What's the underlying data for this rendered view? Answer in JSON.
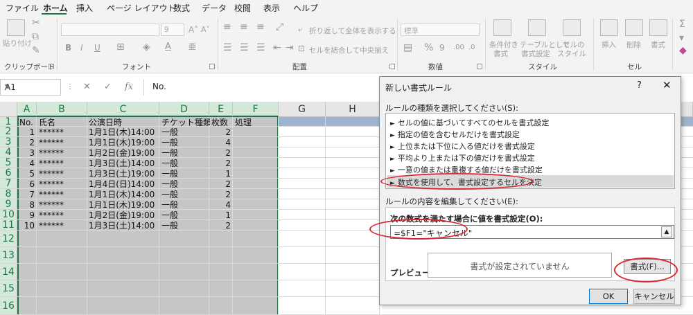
{
  "menu": [
    "ファイル",
    "ホーム",
    "挿入",
    "ページ レイアウト",
    "数式",
    "データ",
    "校閲",
    "表示",
    "ヘルプ"
  ],
  "ribbon": {
    "paste_label": "貼り付け",
    "groups": [
      "クリップボード",
      "フォント",
      "配置",
      "数値",
      "スタイル",
      "セル"
    ],
    "font_size": "9",
    "wrap_text": "折り返して全体を表示する",
    "merge_center": "セルを結合して中央揃え",
    "number_format": "標準",
    "cond_format": [
      "条件付き",
      "書式"
    ],
    "table_format": [
      "テーブルとして",
      "書式設定"
    ],
    "cell_style": [
      "セルの",
      "スタイル"
    ],
    "insert": "挿入",
    "delete": "削除",
    "format": "書式"
  },
  "formula_bar": {
    "name_box": "A1",
    "fx": "fx",
    "value": "No."
  },
  "columns": [
    "A",
    "B",
    "C",
    "D",
    "E",
    "F",
    "G",
    "H"
  ],
  "rows": [
    "1",
    "2",
    "3",
    "4",
    "5",
    "6",
    "7",
    "8",
    "9",
    "10",
    "11",
    "12",
    "13",
    "14",
    "15",
    "16"
  ],
  "table": {
    "headers": [
      "No.",
      "氏名",
      "公演日時",
      "チケット種類",
      "枚数",
      "処理"
    ],
    "rows": [
      [
        "1",
        "******",
        "1月1日(木)14:00",
        "一般",
        "2"
      ],
      [
        "2",
        "******",
        "1月1日(木)19:00",
        "一般",
        "4"
      ],
      [
        "3",
        "******",
        "1月2日(金)19:00",
        "一般",
        "2"
      ],
      [
        "4",
        "******",
        "1月3日(土)14:00",
        "一般",
        "2"
      ],
      [
        "5",
        "******",
        "1月3日(土)19:00",
        "一般",
        "1"
      ],
      [
        "6",
        "******",
        "1月4日(日)14:00",
        "一般",
        "2"
      ],
      [
        "7",
        "******",
        "1月1日(木)14:00",
        "一般",
        "2"
      ],
      [
        "8",
        "******",
        "1月1日(木)19:00",
        "一般",
        "4"
      ],
      [
        "9",
        "******",
        "1月2日(金)19:00",
        "一般",
        "1"
      ],
      [
        "10",
        "******",
        "1月3日(土)14:00",
        "一般",
        "2"
      ]
    ]
  },
  "dialog": {
    "title": "新しい書式ルール",
    "help": "?",
    "close": "✕",
    "rule_type_label": "ルールの種類を選択してください(S):",
    "rule_types": [
      "セルの値に基づいてすべてのセルを書式設定",
      "指定の値を含むセルだけを書式設定",
      "上位または下位に入る値だけを書式設定",
      "平均より上または下の値だけを書式設定",
      "一意の値または重複する値だけを書式設定",
      "数式を使用して、書式設定するセルを決定"
    ],
    "edit_label": "ルールの内容を編集してください(E):",
    "formula_label": "次の数式を満たす場合に値を書式設定(O):",
    "formula_value": "=$F1=\"キャンセル\"",
    "preview_label": "プレビュー:",
    "preview_text": "書式が設定されていません",
    "format_button": "書式(F)...",
    "ok": "OK",
    "cancel": "キャンセル"
  },
  "colors": {
    "accent": "#217346",
    "annotation": "#d8262f",
    "header_fill": "#9fb4d0"
  }
}
